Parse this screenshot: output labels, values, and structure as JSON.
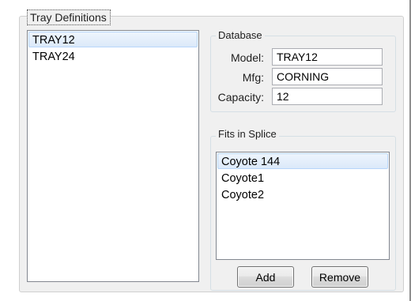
{
  "tray_definitions": {
    "title": "Tray Definitions",
    "items": [
      "TRAY12",
      "TRAY24"
    ],
    "selected_index": 0
  },
  "database": {
    "title": "Database",
    "model_label": "Model:",
    "model_value": "TRAY12",
    "mfg_label": "Mfg:",
    "mfg_value": "CORNING",
    "capacity_label": "Capacity:",
    "capacity_value": "12"
  },
  "fits_in_splice": {
    "title": "Fits in Splice",
    "items": [
      "Coyote 144",
      "Coyote1",
      "Coyote2"
    ],
    "selected_index": 0,
    "add_label": "Add",
    "remove_label": "Remove"
  },
  "colors": {
    "selection_border": "#b8d6fb",
    "panel_background": "#f0f0f0"
  }
}
